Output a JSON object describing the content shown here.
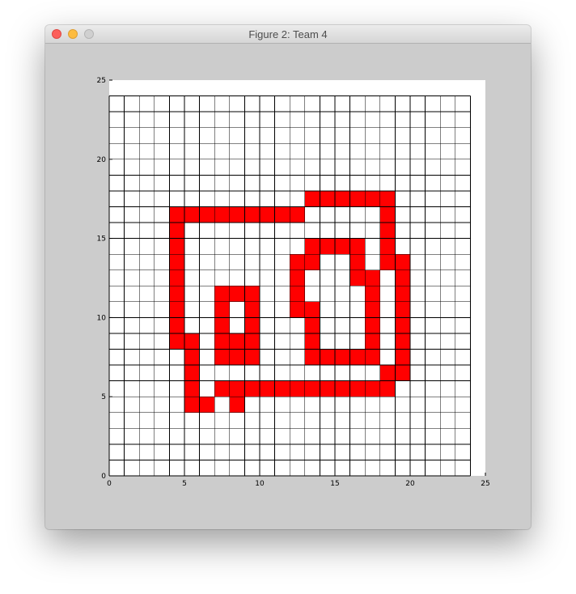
{
  "window": {
    "title": "Figure 2: Team 4"
  },
  "colors": {
    "fill": "#ff0000",
    "grid": "#000000",
    "background": "#ffffff"
  },
  "chart_data": {
    "type": "heatmap",
    "title": "",
    "xlabel": "",
    "ylabel": "",
    "xlim": [
      0,
      25
    ],
    "ylim": [
      0,
      25
    ],
    "grid": true,
    "grid_extent": [
      24,
      24
    ],
    "x_ticks": [
      0,
      5,
      10,
      15,
      20,
      25
    ],
    "y_ticks": [
      0,
      5,
      10,
      15,
      20,
      25
    ],
    "filled_cells": [
      [
        13,
        17
      ],
      [
        14,
        17
      ],
      [
        15,
        17
      ],
      [
        16,
        17
      ],
      [
        17,
        17
      ],
      [
        18,
        17
      ],
      [
        4,
        16
      ],
      [
        5,
        16
      ],
      [
        6,
        16
      ],
      [
        7,
        16
      ],
      [
        8,
        16
      ],
      [
        9,
        16
      ],
      [
        10,
        16
      ],
      [
        11,
        16
      ],
      [
        12,
        16
      ],
      [
        18,
        16
      ],
      [
        4,
        15
      ],
      [
        18,
        15
      ],
      [
        4,
        14
      ],
      [
        13,
        14
      ],
      [
        14,
        14
      ],
      [
        15,
        14
      ],
      [
        16,
        14
      ],
      [
        18,
        14
      ],
      [
        4,
        13
      ],
      [
        12,
        13
      ],
      [
        13,
        13
      ],
      [
        16,
        13
      ],
      [
        18,
        13
      ],
      [
        19,
        13
      ],
      [
        4,
        12
      ],
      [
        12,
        12
      ],
      [
        16,
        12
      ],
      [
        17,
        12
      ],
      [
        19,
        12
      ],
      [
        4,
        11
      ],
      [
        7,
        11
      ],
      [
        8,
        11
      ],
      [
        9,
        11
      ],
      [
        12,
        11
      ],
      [
        17,
        11
      ],
      [
        19,
        11
      ],
      [
        4,
        10
      ],
      [
        7,
        10
      ],
      [
        9,
        10
      ],
      [
        12,
        10
      ],
      [
        13,
        10
      ],
      [
        17,
        10
      ],
      [
        19,
        10
      ],
      [
        4,
        9
      ],
      [
        7,
        9
      ],
      [
        9,
        9
      ],
      [
        13,
        9
      ],
      [
        17,
        9
      ],
      [
        19,
        9
      ],
      [
        4,
        8
      ],
      [
        5,
        8
      ],
      [
        7,
        8
      ],
      [
        8,
        8
      ],
      [
        9,
        8
      ],
      [
        13,
        8
      ],
      [
        17,
        8
      ],
      [
        19,
        8
      ],
      [
        5,
        7
      ],
      [
        7,
        7
      ],
      [
        8,
        7
      ],
      [
        9,
        7
      ],
      [
        13,
        7
      ],
      [
        14,
        7
      ],
      [
        15,
        7
      ],
      [
        16,
        7
      ],
      [
        17,
        7
      ],
      [
        19,
        7
      ],
      [
        5,
        6
      ],
      [
        18,
        6
      ],
      [
        19,
        6
      ],
      [
        5,
        5
      ],
      [
        7,
        5
      ],
      [
        8,
        5
      ],
      [
        9,
        5
      ],
      [
        10,
        5
      ],
      [
        11,
        5
      ],
      [
        12,
        5
      ],
      [
        13,
        5
      ],
      [
        14,
        5
      ],
      [
        15,
        5
      ],
      [
        16,
        5
      ],
      [
        17,
        5
      ],
      [
        18,
        5
      ],
      [
        5,
        4
      ],
      [
        6,
        4
      ],
      [
        8,
        4
      ]
    ]
  }
}
